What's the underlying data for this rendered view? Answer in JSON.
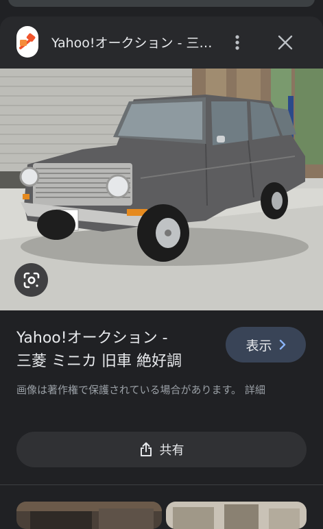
{
  "header": {
    "title": "Yahoo!オークション - 三菱 ミニカ 旧車 絶好調",
    "logo_icon": "yahoo-auction-hammer-icon",
    "more_icon": "more-vert-icon",
    "close_icon": "close-icon"
  },
  "image": {
    "subject": "grey vintage car",
    "lens_icon": "google-lens-icon"
  },
  "result": {
    "title_line1": "Yahoo!オークション -",
    "title_line2": "三菱 ミニカ 旧車 絶好調",
    "view_label": "表示",
    "view_icon": "chevron-right-icon"
  },
  "copyright_notice": "画像は著作権で保護されている場合があります。 詳細",
  "share": {
    "label": "共有",
    "icon": "share-icon"
  },
  "colors": {
    "background": "#202124",
    "header": "#28292c",
    "view_button": "#394457",
    "share_button": "#303134",
    "logo_orange": "#f0542c"
  }
}
